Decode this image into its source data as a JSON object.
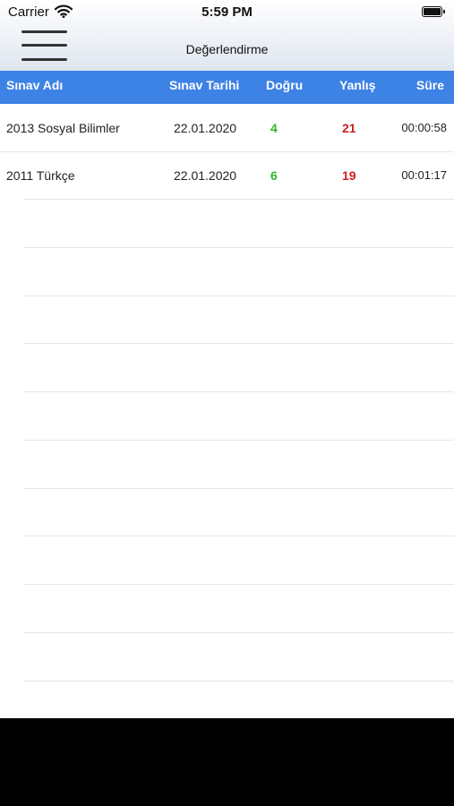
{
  "status_bar": {
    "carrier": "Carrier",
    "time": "5:59 PM"
  },
  "nav": {
    "title": "Değerlendirme"
  },
  "table": {
    "columns": [
      "Sınav Adı",
      "Sınav Tarihi",
      "Doğru",
      "Yanlış",
      "Süre"
    ],
    "rows": [
      {
        "name": "2013 Sosyal Bilimler",
        "date": "22.01.2020",
        "correct": "4",
        "wrong": "21",
        "duration": "00:00:58"
      },
      {
        "name": "2011 Türkçe",
        "date": "22.01.2020",
        "correct": "6",
        "wrong": "19",
        "duration": "00:01:17"
      }
    ]
  },
  "colors": {
    "header_background": "#3d82e5",
    "correct": "#2fb52f",
    "wrong": "#cc2020"
  },
  "icons": [
    "wifi-icon",
    "battery-icon",
    "hamburger-menu-icon"
  ]
}
